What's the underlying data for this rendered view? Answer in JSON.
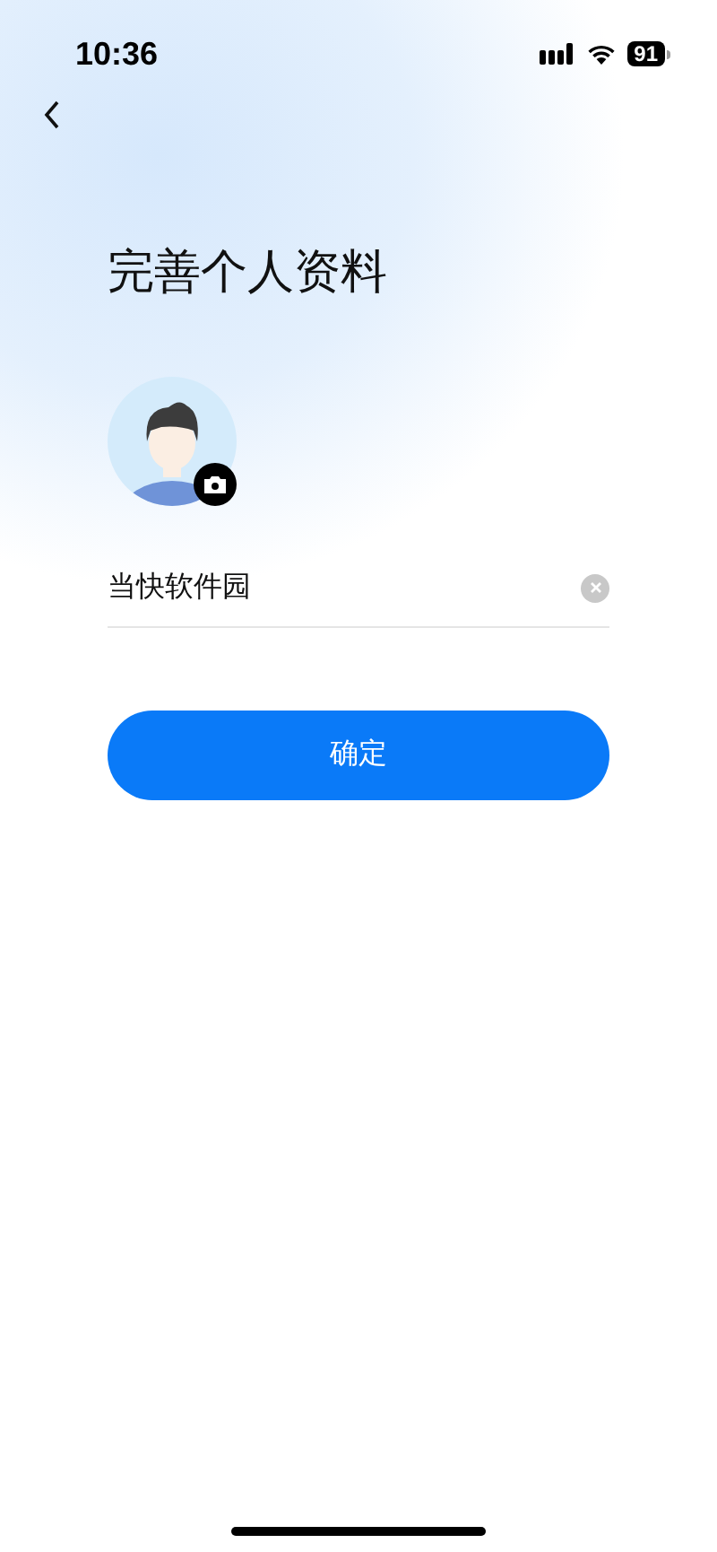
{
  "status_bar": {
    "time": "10:36",
    "battery": "91"
  },
  "title": "完善个人资料",
  "name_field": {
    "value": "当快软件园"
  },
  "confirm_button": {
    "label": "确定"
  }
}
